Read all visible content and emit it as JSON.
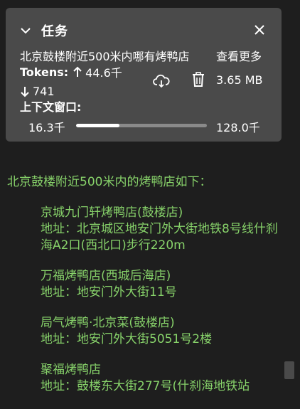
{
  "panel": {
    "title": "任务",
    "query": "北京鼓楼附近500米内哪有烤鸭店",
    "see_more": "查看更多",
    "tokens_label": "Tokens:",
    "tokens_up": "44.6千",
    "tokens_down": "741",
    "size": "3.65 MB",
    "context_label": "上下文窗口:",
    "context_used": "16.3千",
    "context_max": "128.0千",
    "context_fraction": 0.33
  },
  "content": {
    "intro": "北京鼓楼附近500米内的烤鸭店如下：",
    "entries": [
      {
        "name": "京城九门轩烤鸭店(鼓楼店)",
        "address": "地址：北京城区地安门外大街地铁8号线什刹海A2口(西北口)步行220m"
      },
      {
        "name": "万福烤鸭店(西城后海店)",
        "address": "地址：地安门外大街11号"
      },
      {
        "name": "局气烤鸭·北京菜(鼓楼店)",
        "address": "地址：地安门外大街5051号2楼"
      },
      {
        "name": "聚福烤鸭店",
        "address": "地址：鼓楼东大街277号(什刹海地铁站"
      }
    ]
  }
}
